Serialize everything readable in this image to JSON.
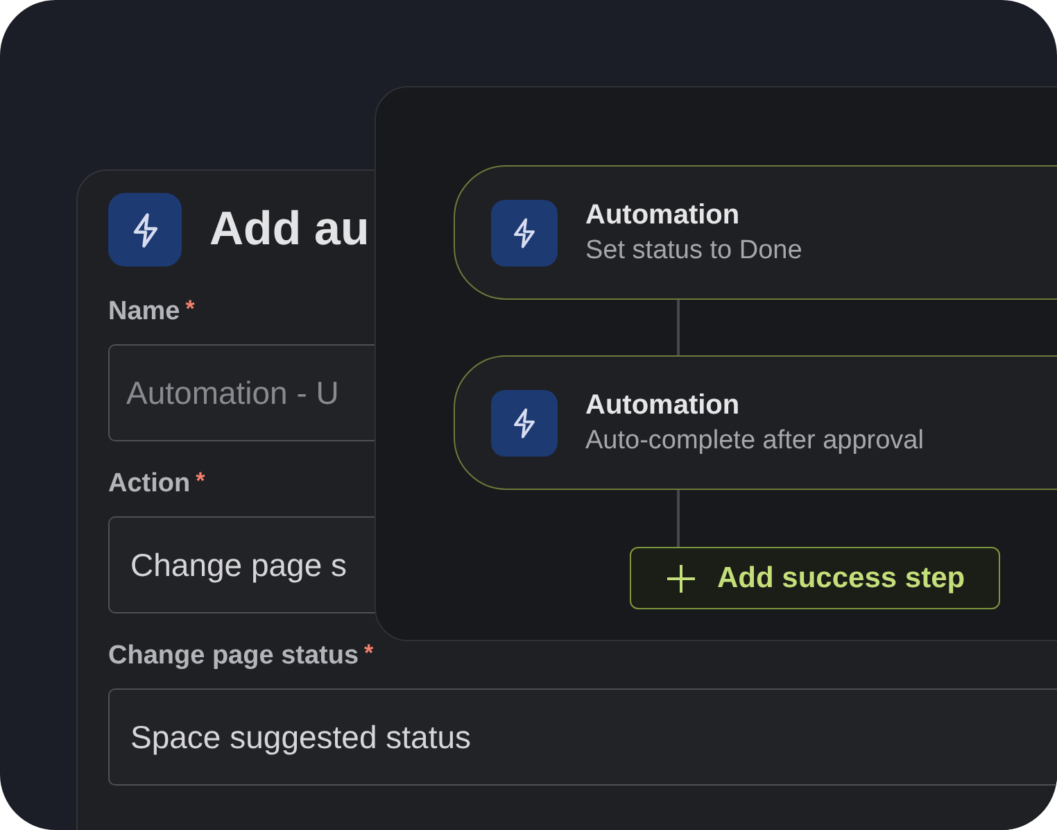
{
  "form": {
    "title": "Add au",
    "fields": [
      {
        "label": "Name",
        "marker": "*",
        "placeholder": "Automation - U"
      },
      {
        "label": "Action",
        "marker": "*",
        "value": "Change page s"
      },
      {
        "label": "Change page status",
        "marker": "*",
        "value": "Space suggested status"
      }
    ]
  },
  "flow": {
    "steps": [
      {
        "title": "Automation",
        "subtitle": "Set status to Done"
      },
      {
        "title": "Automation",
        "subtitle": "Auto-complete after approval"
      }
    ],
    "add_button": {
      "label": "Add success step"
    }
  }
}
